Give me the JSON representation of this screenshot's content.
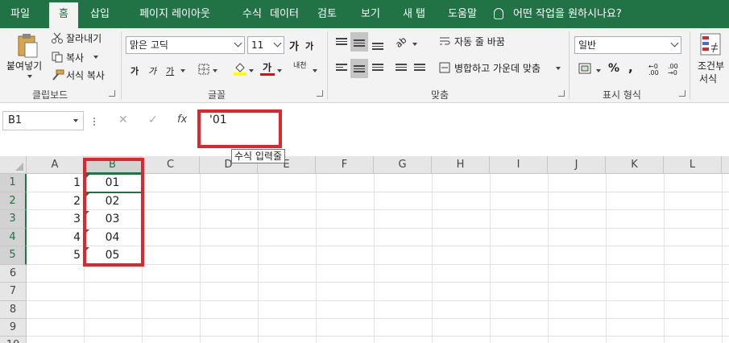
{
  "tabs": [
    "파일",
    "홈",
    "삽입",
    "페이지 레이아웃",
    "수식",
    "데이터",
    "검토",
    "보기",
    "새 탭",
    "도움말"
  ],
  "active_tab": "홈",
  "tell_me": "어떤 작업을 원하시나요?",
  "clipboard": {
    "paste": "붙여넣기",
    "cut": "잘라내기",
    "copy": "복사",
    "format_painter": "서식 복사",
    "label": "클립보드"
  },
  "font": {
    "name": "맑은 고딕",
    "size": "11",
    "grow": "가",
    "shrink": "가",
    "bold": "가",
    "italic": "가",
    "underline": "가",
    "font_color": "가",
    "phonetic": "내천",
    "label": "글꼴"
  },
  "alignment": {
    "wrap_text": "자동 줄 바꿈",
    "merge_center": "병합하고 가운데 맞춤",
    "orientation_glyph": "ab",
    "label": "맞춤"
  },
  "number": {
    "format": "일반",
    "percent": "%",
    "comma": ",",
    "label": "표시 형식"
  },
  "styles": {
    "conditional_line1": "조건부",
    "conditional_line2": "서식"
  },
  "formula_bar": {
    "name_box": "B1",
    "cancel": "✕",
    "enter": "✓",
    "fx": "fx",
    "content": "'01",
    "tooltip": "수식 입력줄"
  },
  "columns": [
    "A",
    "B",
    "C",
    "D",
    "E",
    "F",
    "G",
    "H",
    "I",
    "J",
    "K",
    "L"
  ],
  "rows": [
    "1",
    "2",
    "3",
    "4",
    "5",
    "6",
    "7",
    "8",
    "9",
    "10"
  ],
  "colA": [
    "1",
    "2",
    "3",
    "4",
    "5"
  ],
  "colB": [
    "01",
    "02",
    "03",
    "04",
    "05"
  ],
  "colors": {
    "brand": "#217346",
    "highlight": "#e0262d",
    "fill_yellow": "#ffff00",
    "font_red": "#ff0000"
  }
}
